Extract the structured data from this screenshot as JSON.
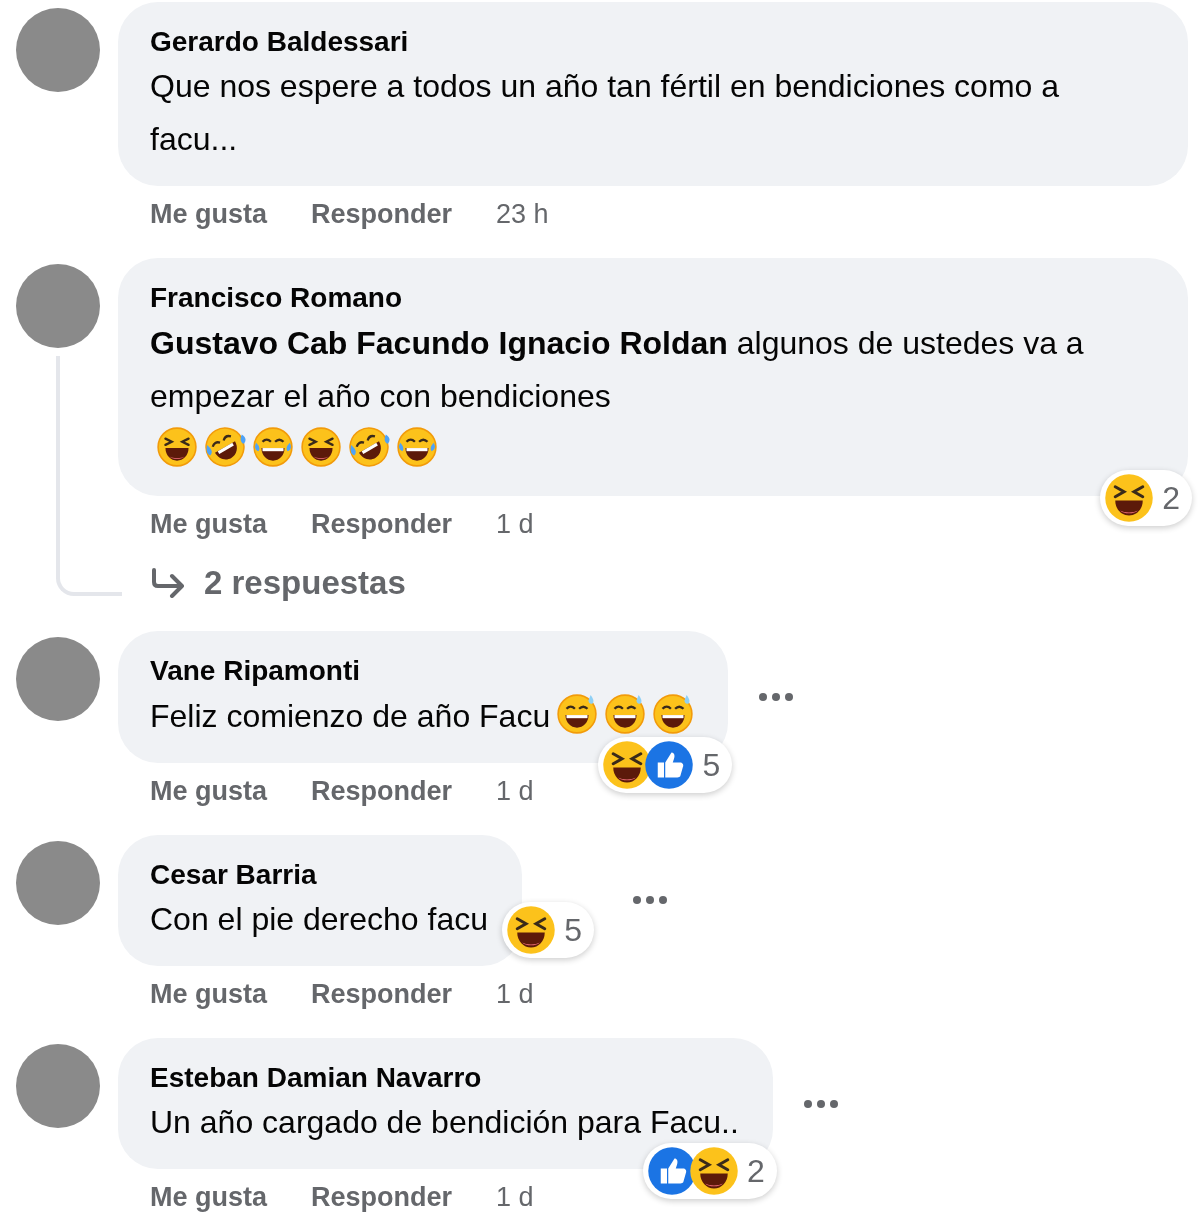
{
  "comments": [
    {
      "author": "Gerardo Baldessari",
      "text": "Que nos espere a todos un año tan fértil en bendiciones como a facu...",
      "actions": [
        "Me gusta",
        "Responder"
      ],
      "time": "23 h"
    },
    {
      "author": "Francisco Romano",
      "text": "**Gustavo Cab Facundo Ignacio Roldan** algunos de ustedes va a empezar el año con bendiciones",
      "emojis": [
        {
          "kind": "squint"
        },
        {
          "kind": "rofl"
        },
        {
          "kind": "joy"
        },
        {
          "kind": "squint"
        },
        {
          "kind": "rofl"
        },
        {
          "kind": "joy"
        }
      ],
      "reactions": {
        "items": [
          {
            "kind": "haha"
          }
        ],
        "count": "2"
      },
      "actions": [
        "Me gusta",
        "Responder"
      ],
      "time": "1 d",
      "replies": "2 respuestas"
    },
    {
      "author": "Vane Ripamonti",
      "text": "Feliz comienzo de año Facu",
      "emojis": [
        {
          "kind": "sweat"
        },
        {
          "kind": "sweat"
        },
        {
          "kind": "sweat"
        }
      ],
      "reactions": {
        "items": [
          {
            "kind": "haha"
          },
          {
            "kind": "like"
          }
        ],
        "count": "5"
      },
      "actions": [
        "Me gusta",
        "Responder"
      ],
      "time": "1 d",
      "has_menu": true
    },
    {
      "author": "Cesar Barria",
      "text": "Con el pie derecho facu",
      "reactions": {
        "items": [
          {
            "kind": "haha"
          }
        ],
        "count": "5"
      },
      "actions": [
        "Me gusta",
        "Responder"
      ],
      "time": "1 d",
      "has_menu": true
    },
    {
      "author": "Esteban Damian Navarro",
      "text": "Un año cargado de bendición para Facu..",
      "reactions": {
        "items": [
          {
            "kind": "like"
          },
          {
            "kind": "haha"
          }
        ],
        "count": "2"
      },
      "actions": [
        "Me gusta",
        "Responder"
      ],
      "time": "1 d",
      "has_menu": true
    }
  ]
}
